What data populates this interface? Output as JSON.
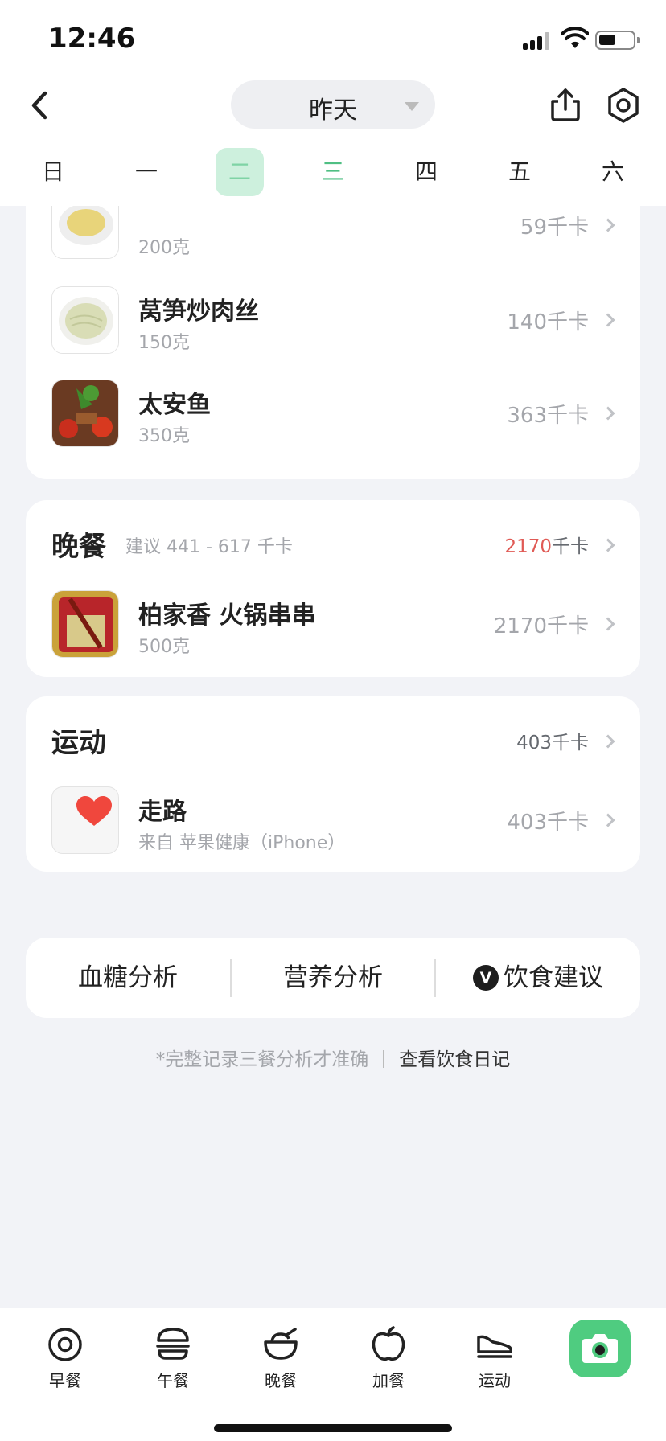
{
  "status_bar": {
    "time": "12:46"
  },
  "header": {
    "date_label": "昨天"
  },
  "weekdays": [
    {
      "label": "日"
    },
    {
      "label": "一"
    },
    {
      "label": "二"
    },
    {
      "label": "三"
    },
    {
      "label": "四"
    },
    {
      "label": "五"
    },
    {
      "label": "六"
    }
  ],
  "lunch_tail": {
    "items": [
      {
        "name": "",
        "amount": "200克",
        "kcal": "59千卡"
      },
      {
        "name": "莴笋炒肉丝",
        "amount": "150克",
        "kcal": "140千卡"
      },
      {
        "name": "太安鱼",
        "amount": "350克",
        "kcal": "363千卡"
      }
    ]
  },
  "dinner": {
    "title": "晚餐",
    "hint": "建议 441 - 617 千卡",
    "total_value": "2170",
    "total_unit": "千卡",
    "items": [
      {
        "name": "柏家香 火锅串串",
        "amount": "500克",
        "kcal": "2170千卡"
      }
    ]
  },
  "exercise": {
    "title": "运动",
    "total": "403千卡",
    "items": [
      {
        "name": "走路",
        "source": "来自 苹果健康（iPhone）",
        "kcal": "403千卡"
      }
    ]
  },
  "analysis": {
    "blood_sugar": "血糖分析",
    "nutrition": "营养分析",
    "diet_advice": "饮食建议",
    "logo_letter": "V"
  },
  "footnote": {
    "note": "*完整记录三餐分析才准确",
    "link": "查看饮食日记"
  },
  "tabbar": {
    "breakfast": "早餐",
    "lunch": "午餐",
    "dinner": "晚餐",
    "snack": "加餐",
    "exercise": "运动"
  },
  "colors": {
    "accent_green": "#4fcc80",
    "over_red": "#e05a55",
    "selected_day_bg": "#cdf0dd"
  }
}
